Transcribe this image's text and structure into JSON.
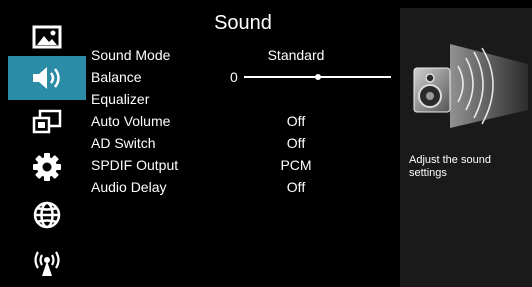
{
  "menu": {
    "title": "Sound",
    "sidebar": [
      {
        "icon": "picture-icon",
        "active": false
      },
      {
        "icon": "speaker-icon",
        "active": true
      },
      {
        "icon": "input-source-icon",
        "active": false
      },
      {
        "icon": "gear-icon",
        "active": false
      },
      {
        "icon": "globe-icon",
        "active": false
      },
      {
        "icon": "broadcast-icon",
        "active": false
      }
    ],
    "items": [
      {
        "label": "Sound Mode",
        "value": "Standard"
      },
      {
        "label": "Balance",
        "value": "0",
        "level": 0.5,
        "range": [
          -50,
          50
        ]
      },
      {
        "label": "Equalizer",
        "value": ""
      },
      {
        "label": "Auto Volume",
        "value": "Off"
      },
      {
        "label": "AD Switch",
        "value": "Off"
      },
      {
        "label": "SPDIF Output",
        "value": "PCM"
      },
      {
        "label": "Audio Delay",
        "value": "Off"
      }
    ]
  },
  "info": {
    "description": "Adjust the sound settings"
  },
  "colors": {
    "accent": "#2b8ca7",
    "background": "#000000",
    "panel": "#1a1a1a",
    "text": "#ffffff"
  }
}
